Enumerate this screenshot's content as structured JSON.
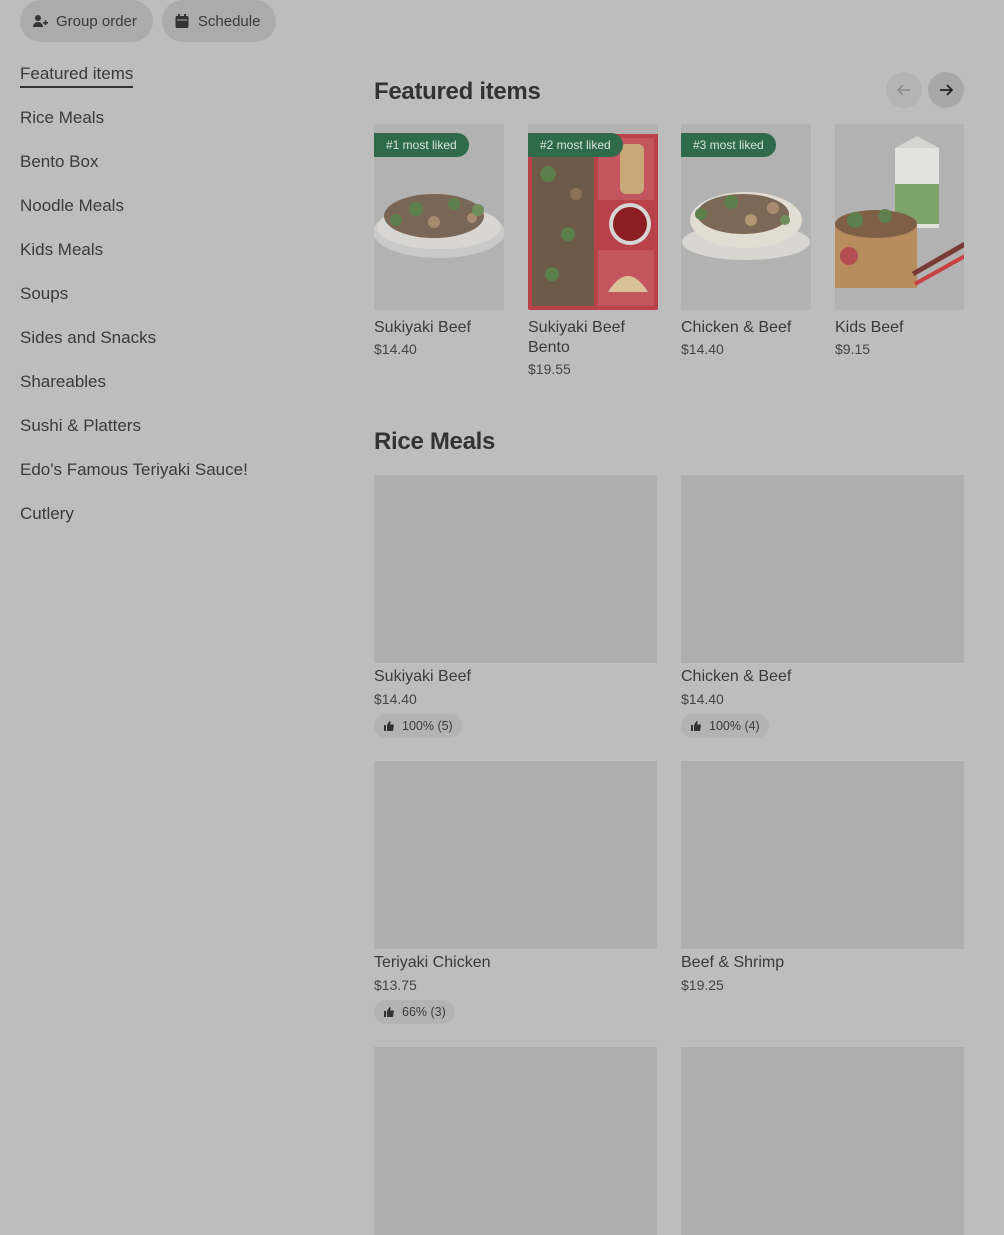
{
  "topbar": {
    "group_order_label": "Group order",
    "schedule_label": "Schedule"
  },
  "sidebar": {
    "items": [
      {
        "label": "Featured items",
        "active": true
      },
      {
        "label": "Rice Meals"
      },
      {
        "label": "Bento Box"
      },
      {
        "label": "Noodle Meals"
      },
      {
        "label": "Kids Meals"
      },
      {
        "label": "Soups"
      },
      {
        "label": "Sides and Snacks"
      },
      {
        "label": "Shareables"
      },
      {
        "label": "Sushi & Platters"
      },
      {
        "label": "Edo's Famous Teriyaki Sauce!"
      },
      {
        "label": "Cutlery"
      }
    ]
  },
  "featured": {
    "title": "Featured items",
    "items": [
      {
        "badge": "#1 most liked",
        "name": "Sukiyaki Beef",
        "price": "$14.40"
      },
      {
        "badge": "#2 most liked",
        "name": "Sukiyaki Beef Bento",
        "price": "$19.55"
      },
      {
        "badge": "#3 most liked",
        "name": "Chicken & Beef",
        "price": "$14.40"
      },
      {
        "badge": "",
        "name": "Kids Beef",
        "price": "$9.15"
      }
    ]
  },
  "rice_meals": {
    "title": "Rice Meals",
    "items": [
      {
        "name": "Sukiyaki Beef",
        "price": "$14.40",
        "rating": "100% (5)"
      },
      {
        "name": "Chicken & Beef",
        "price": "$14.40",
        "rating": "100% (4)"
      },
      {
        "name": "Teriyaki Chicken",
        "price": "$13.75",
        "rating": "66% (3)"
      },
      {
        "name": "Beef & Shrimp",
        "price": "$19.25",
        "rating": ""
      },
      {
        "name": "",
        "price": "",
        "rating": ""
      },
      {
        "name": "",
        "price": "",
        "rating": ""
      }
    ]
  },
  "colors": {
    "overlay_bg": "#bdbdbd",
    "badge_green": "#2f6a4a"
  }
}
